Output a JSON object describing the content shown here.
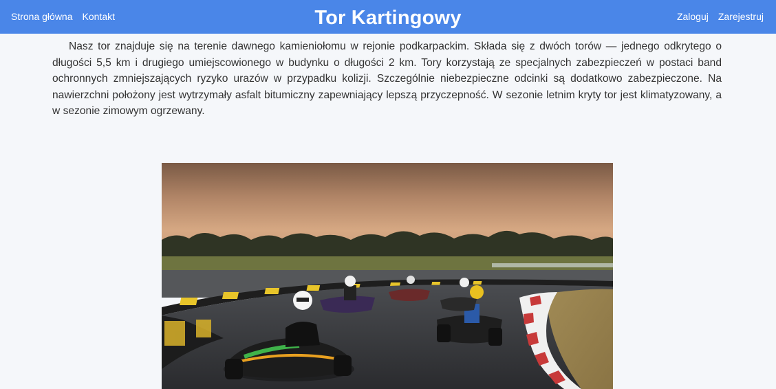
{
  "nav": {
    "left_links": [
      {
        "label": "Strona główna"
      },
      {
        "label": "Kontakt"
      }
    ],
    "title": "Tor Kartingowy",
    "right_links": [
      {
        "label": "Zaloguj"
      },
      {
        "label": "Zarejestruj"
      }
    ]
  },
  "main": {
    "description": "Nasz tor znajduje się na terenie dawnego kamieniołomu w rejonie podkarpackim. Składa się z dwóch torów — jednego odkrytego o długości 5,5 km i drugiego umiejscowionego w budynku o długości 2 km. Tory korzystają ze specjalnych zabezpieczeń w postaci band ochronnych zmniejszających ryzyko urazów w przypadku kolizji. Szczególnie niebezpieczne odcinki są dodatkowo zabezpieczone. Na nawierzchni położony jest wytrzymały asfalt bitumiczny zapewniający lepszą przyczepność. W sezonie letnim kryty tor jest klimatyzowany, a w sezonie zimowym ogrzewany."
  },
  "colors": {
    "navbar": "#4a86e8",
    "page_background": "#f5f7fa",
    "text": "#333333"
  }
}
